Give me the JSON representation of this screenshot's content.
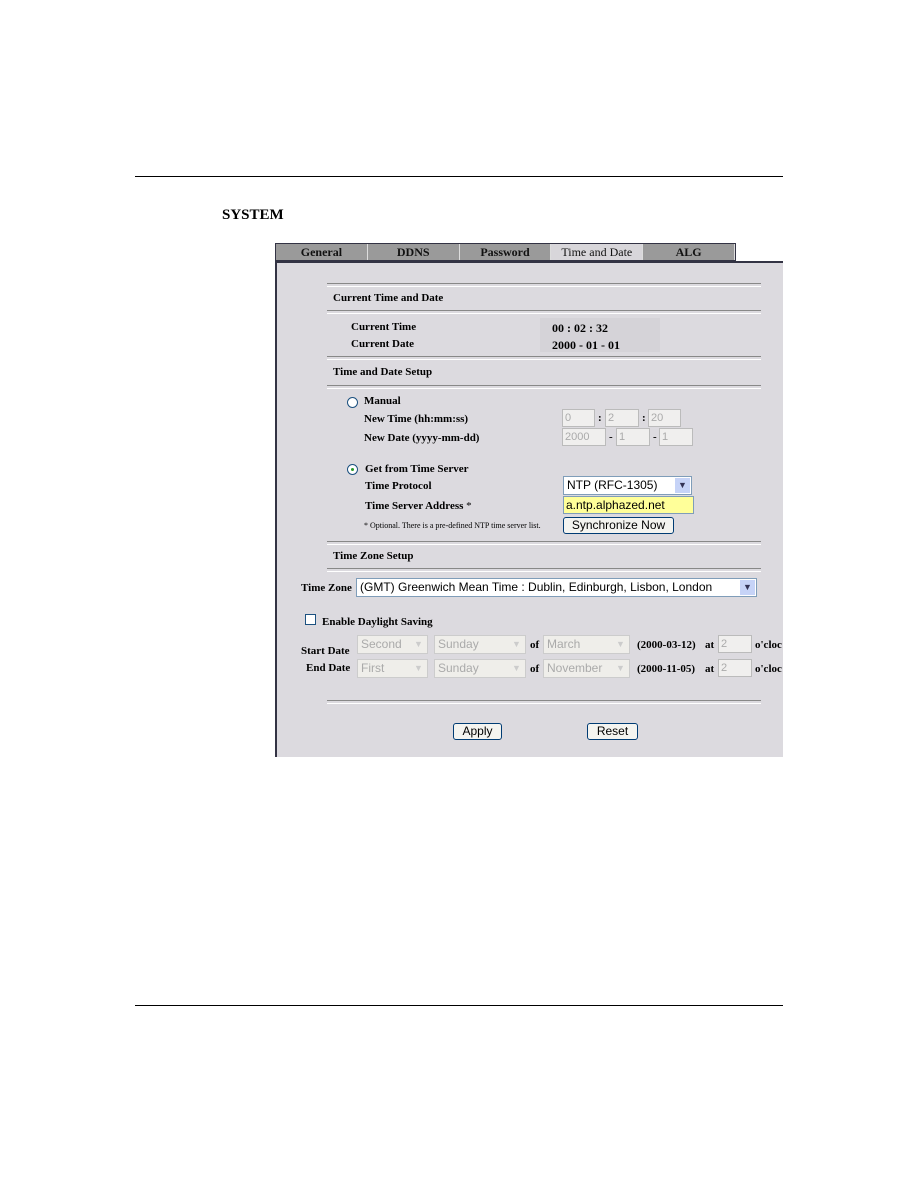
{
  "page": {
    "title": "SYSTEM"
  },
  "tabs": [
    {
      "label": "General"
    },
    {
      "label": "DDNS"
    },
    {
      "label": "Password"
    },
    {
      "label": "Time and Date",
      "active": true
    },
    {
      "label": "ALG"
    }
  ],
  "current": {
    "heading": "Current Time and Date",
    "time_label": "Current Time",
    "time_value": "00 : 02 : 32",
    "date_label": "Current Date",
    "date_value": "2000 - 01 - 01"
  },
  "setup": {
    "heading": "Time and Date Setup",
    "manual_label": "Manual",
    "manual_selected": false,
    "new_time_label": "New Time (hh:mm:ss)",
    "hh": "0",
    "mm": "2",
    "ss": "20",
    "new_date_label": "New Date (yyyy-mm-dd)",
    "yyyy": "2000",
    "month": "1",
    "day": "1",
    "colon": ":",
    "dash": "-",
    "server_label": "Get from Time Server",
    "server_selected": true,
    "protocol_label": "Time Protocol",
    "protocol_value": "NTP (RFC-1305)",
    "address_label": "Time Server Address",
    "asterisk": "*",
    "address_value": "a.ntp.alphazed.net",
    "note": "* Optional. There is a pre-defined NTP time server list.",
    "sync_button": "Synchronize Now"
  },
  "timezone": {
    "heading": "Time Zone Setup",
    "label": "Time Zone",
    "value": "(GMT) Greenwich Mean Time : Dublin, Edinburgh, Lisbon, London",
    "dst_label": "Enable Daylight Saving",
    "dst_enabled": false,
    "start_label": "Start Date",
    "start_week": "Second",
    "start_day": "Sunday",
    "start_month": "March",
    "start_date": "(2000-03-12)",
    "start_hour": "2",
    "end_label": "End Date",
    "end_week": "First",
    "end_day": "Sunday",
    "end_month": "November",
    "end_date": "(2000-11-05)",
    "end_hour": "2",
    "of": "of",
    "at": "at",
    "oclock": "o'cloc"
  },
  "buttons": {
    "apply": "Apply",
    "reset": "Reset"
  },
  "colors": {
    "highlight_input": "#ffff99",
    "panel_bg": "#dcdadf",
    "tab_bg": "#9a9a9a"
  }
}
